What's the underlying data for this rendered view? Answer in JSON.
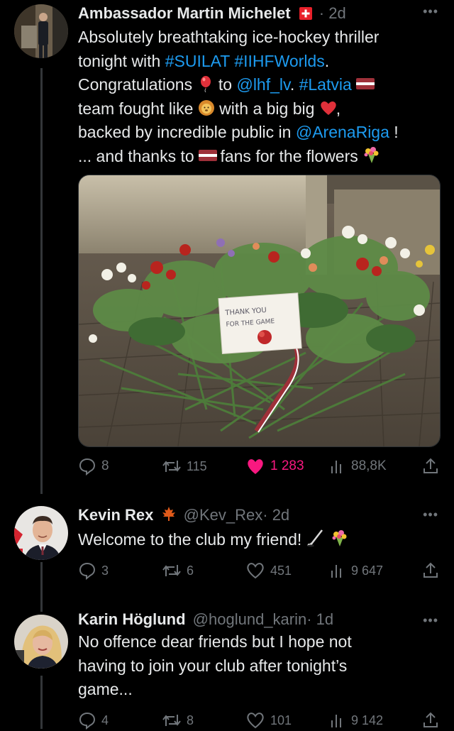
{
  "posts": [
    {
      "author": {
        "name": "Ambassador Martin Michelet",
        "handle": "",
        "time": "· 2d"
      },
      "text": {
        "l1": "Absolutely breathtaking ice-hockey thriller",
        "l2_a": "tonight with ",
        "l2_h1": "#SUILAT",
        "l2_h2": "#IIHFWorlds",
        "l2_end": ".",
        "l3_a": "Congratulations ",
        "l3_b": " to ",
        "l3_m": "@lhf_lv",
        "l3_c": ". ",
        "l3_h": "#Latvia",
        "l4_a": "team fought like ",
        "l4_b": " with a big big ",
        "l4_c": ",",
        "l5_a": "backed by incredible public in ",
        "l5_m": "@ArenaRiga",
        "l5_b": " !",
        "l6_a": "... and thanks to ",
        "l6_b": " fans for the flowers "
      },
      "media": {
        "note_l1": "THANK   YOU",
        "note_l2": "FOR THE GAME"
      },
      "stats": {
        "replies": "8",
        "reposts": "115",
        "likes": "1 283",
        "views": "88,8K"
      }
    },
    {
      "author": {
        "name": "Kevin Rex",
        "handle": "@Kev_Rex",
        "time": "· 2d"
      },
      "text": {
        "l1": "Welcome to the club my friend! "
      },
      "stats": {
        "replies": "3",
        "reposts": "6",
        "likes": "451",
        "views": "9 647"
      }
    },
    {
      "author": {
        "name": "Karin Höglund",
        "handle": "@hoglund_karin",
        "time": "· 1d"
      },
      "text": {
        "l1": "No offence dear friends but I hope not",
        "l2": "having to join your club after tonight’s",
        "l3": "game..."
      },
      "stats": {
        "replies": "4",
        "reposts": "8",
        "likes": "101",
        "views": "9 142"
      }
    }
  ],
  "colors": {
    "background": "#000000",
    "text": "#e7e9ea",
    "muted": "#71767b",
    "link": "#1d9bf0",
    "like": "#f91880",
    "thread_line": "#333639"
  }
}
